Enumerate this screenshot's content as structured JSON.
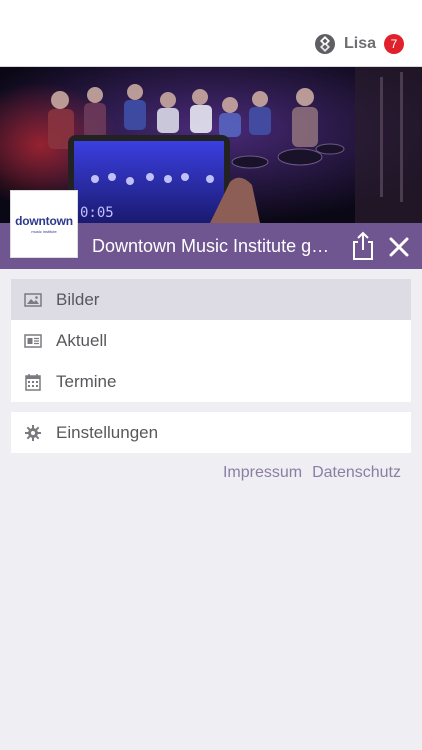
{
  "header": {
    "user_name": "Lisa",
    "notification_count": "7",
    "app_icon": "app-logo-icon"
  },
  "hero": {
    "screen_time": "0:05"
  },
  "organization": {
    "title": "Downtown Music Institute gG...",
    "logo_text": "downtown",
    "logo_subtext": "music institute"
  },
  "menu": {
    "items": [
      {
        "label": "Bilder",
        "icon": "image-icon",
        "active": true
      },
      {
        "label": "Aktuell",
        "icon": "newspaper-icon",
        "active": false
      },
      {
        "label": "Termine",
        "icon": "calendar-icon",
        "active": false
      }
    ],
    "settings": {
      "label": "Einstellungen",
      "icon": "gear-icon"
    }
  },
  "footer": {
    "impressum": "Impressum",
    "datenschutz": "Datenschutz"
  },
  "colors": {
    "accent": "#6f5690",
    "badge": "#e0212b",
    "background": "#efeef3"
  }
}
